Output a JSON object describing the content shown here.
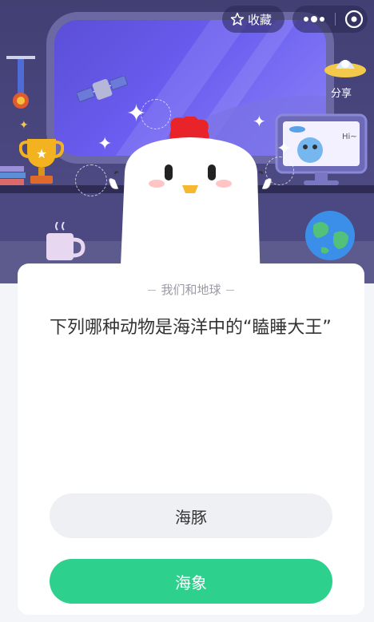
{
  "toolbar": {
    "favorite_label": "收藏",
    "favorite_icon": "star-outline-icon",
    "more_icon": "more-dots-icon",
    "close_icon": "close-circle-icon"
  },
  "share": {
    "label": "分享",
    "icon": "ufo-share-icon"
  },
  "monitor": {
    "greeting": "Hi~"
  },
  "quiz": {
    "category": "我们和地球",
    "question": "下列哪种动物是海洋中的“瞌睡大王”",
    "options": [
      {
        "label": "海豚",
        "style": "neutral"
      },
      {
        "label": "海象",
        "style": "highlight"
      }
    ]
  },
  "colors": {
    "accent_green": "#2dd18d",
    "scene_purple": "#423f73",
    "window_violet": "#6a5df0"
  }
}
